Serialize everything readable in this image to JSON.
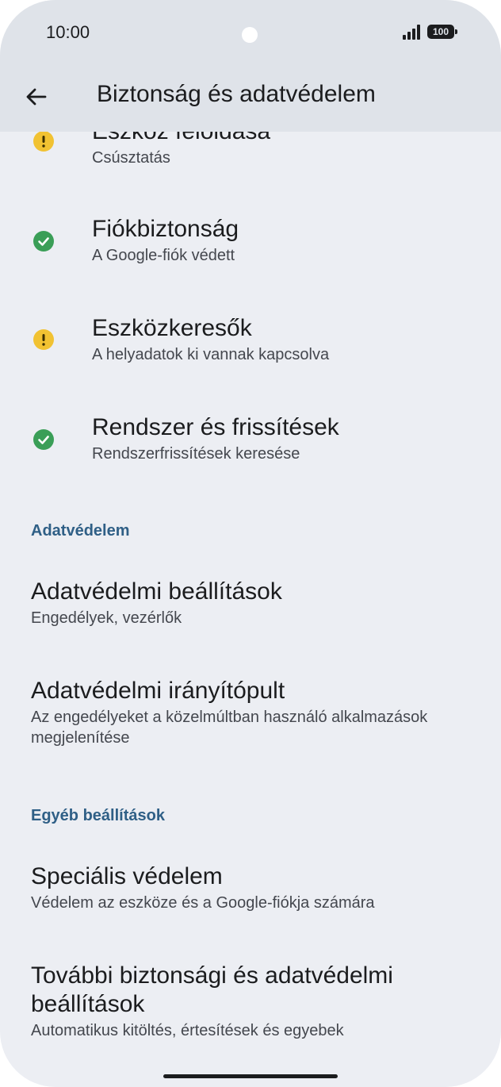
{
  "status_bar": {
    "time": "10:00",
    "battery": "100"
  },
  "app_bar": {
    "title": "Biztonság és adatvédelem"
  },
  "security_items": [
    {
      "title": "Eszköz feloldása",
      "subtitle": "Csúsztatás",
      "status": "warning"
    },
    {
      "title": "Fiókbiztonság",
      "subtitle": "A Google-fiók védett",
      "status": "ok"
    },
    {
      "title": "Eszközkeresők",
      "subtitle": "A helyadatok ki vannak kapcsolva",
      "status": "warning"
    },
    {
      "title": "Rendszer és frissítések",
      "subtitle": "Rendszerfrissítések keresése",
      "status": "ok"
    }
  ],
  "privacy_section": {
    "header": "Adatvédelem",
    "items": [
      {
        "title": "Adatvédelmi beállítások",
        "subtitle": "Engedélyek, vezérlők"
      },
      {
        "title": "Adatvédelmi irányítópult",
        "subtitle": "Az engedélyeket a közelmúltban használó alkalmazások megjelenítése"
      }
    ]
  },
  "other_section": {
    "header": "Egyéb beállítások",
    "items": [
      {
        "title": "Speciális védelem",
        "subtitle": "Védelem az eszköze és a Google-fiókja számára"
      },
      {
        "title": "További biztonsági és adatvédelmi beállítások",
        "subtitle": "Automatikus kitöltés, értesítések és egyebek"
      }
    ]
  },
  "colors": {
    "warning": "#f1c232",
    "ok": "#3a9e57",
    "section": "#2f5f86",
    "bar": "#dfe3e9"
  }
}
